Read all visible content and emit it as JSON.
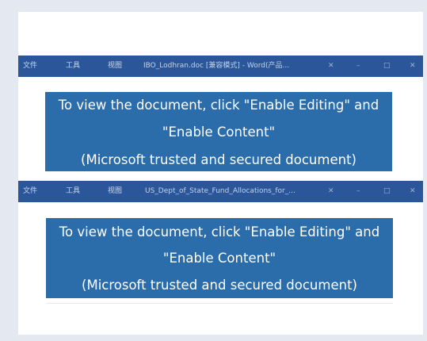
{
  "windows": [
    {
      "menu": [
        "文件",
        "工具",
        "视图"
      ],
      "doc_title": "IBO_Lodhran.doc [兼容模式] - Word(产品...",
      "controls": [
        "✕",
        "–",
        "□",
        "✕"
      ],
      "message": {
        "line1": "To view the document, click \"Enable Editing\" and",
        "line2": "\"Enable Content\"",
        "line3": "(Microsoft trusted and secured document)"
      }
    },
    {
      "menu": [
        "文件",
        "工具",
        "视图"
      ],
      "doc_title": "US_Dept_of_State_Fund_Allocations_for_...",
      "controls": [
        "✕",
        "–",
        "□",
        "✕"
      ],
      "message": {
        "line1": "To view the document, click \"Enable Editing\" and",
        "line2": "\"Enable Content\"",
        "line3": "(Microsoft trusted and secured document)"
      }
    }
  ]
}
